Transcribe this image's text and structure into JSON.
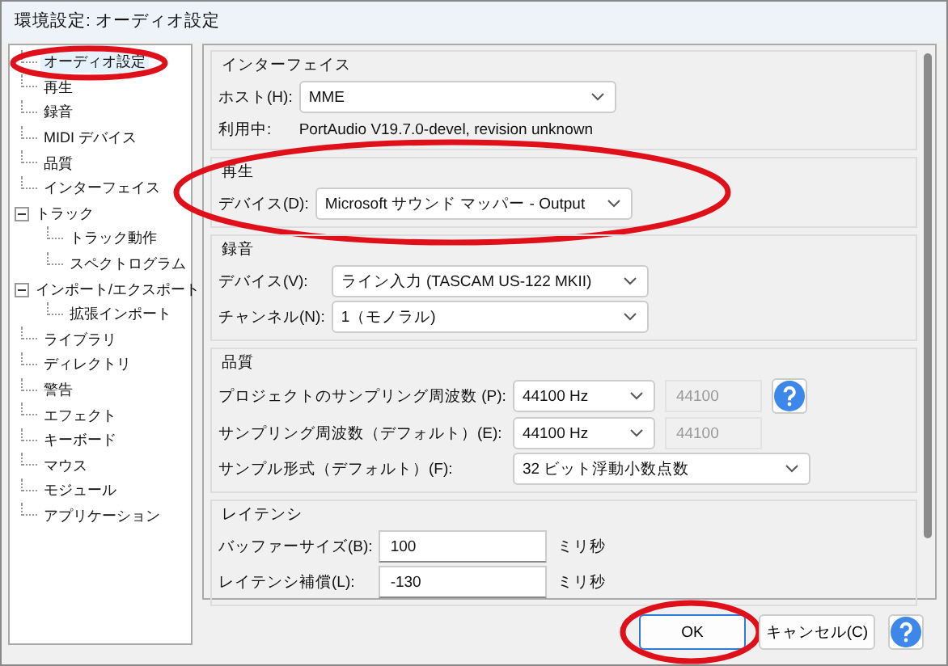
{
  "window": {
    "title": "環境設定: オーディオ設定"
  },
  "sidebar": {
    "items": [
      {
        "label": "オーディオ設定",
        "selected": true,
        "circled": true
      },
      {
        "label": "再生",
        "selected": false
      },
      {
        "label": "録音",
        "selected": false
      },
      {
        "label": "MIDI デバイス",
        "selected": false
      },
      {
        "label": "品質",
        "selected": false
      },
      {
        "label": "インターフェイス",
        "selected": false
      },
      {
        "label": "トラック",
        "selected": false,
        "expanded": true,
        "children": [
          {
            "label": "トラック動作",
            "selected": false
          },
          {
            "label": "スペクトログラム",
            "selected": false
          }
        ]
      },
      {
        "label": "インポート/エクスポート",
        "selected": false,
        "expanded": true,
        "children": [
          {
            "label": "拡張インポート",
            "selected": false
          }
        ]
      },
      {
        "label": "ライブラリ",
        "selected": false
      },
      {
        "label": "ディレクトリ",
        "selected": false
      },
      {
        "label": "警告",
        "selected": false
      },
      {
        "label": "エフェクト",
        "selected": false
      },
      {
        "label": "キーボード",
        "selected": false
      },
      {
        "label": "マウス",
        "selected": false
      },
      {
        "label": "モジュール",
        "selected": false
      },
      {
        "label": "アプリケーション",
        "selected": false
      }
    ]
  },
  "sections": [
    {
      "title": "インターフェイス",
      "rows": [
        {
          "kind": "combo",
          "label": "ホスト(H):",
          "value": "MME"
        },
        {
          "kind": "info",
          "label": "利用中:",
          "value": "PortAudio V19.7.0-devel, revision unknown"
        }
      ]
    },
    {
      "title": "再生",
      "circled": true,
      "rows": [
        {
          "kind": "combo",
          "label": "デバイス(D):",
          "value": "Microsoft サウンド マッパー - Output"
        }
      ]
    },
    {
      "title": "録音",
      "rows": [
        {
          "kind": "combo",
          "label": "デバイス(V):",
          "value": "ライン入力 (TASCAM US-122 MKII)"
        },
        {
          "kind": "combo",
          "label": "チャンネル(N):",
          "value": "1（モノラル)"
        }
      ]
    },
    {
      "title": "品質",
      "rows": [
        {
          "kind": "rate",
          "label": "プロジェクトのサンプリング周波数 (P):",
          "value": "44100 Hz",
          "readout": "44100",
          "help": true
        },
        {
          "kind": "rate",
          "label": "サンプリング周波数（デフォルト）(E):",
          "value": "44100 Hz",
          "readout": "44100"
        },
        {
          "kind": "wide",
          "label": "サンプル形式（デフォルト）(F):",
          "value": "32 ビット浮動小数点数"
        }
      ]
    },
    {
      "title": "レイテンシ",
      "rows": [
        {
          "kind": "number",
          "label": "バッファーサイズ(B):",
          "value": "100",
          "unit": "ミリ秒"
        },
        {
          "kind": "number",
          "label": "レイテンシ補償(L):",
          "value": "-130",
          "unit": "ミリ秒"
        }
      ]
    }
  ],
  "buttons": [
    {
      "kind": "ok",
      "label": "OK",
      "circled": true
    },
    {
      "kind": "cancel",
      "label": "キャンセル(C)"
    },
    {
      "kind": "help"
    }
  ]
}
